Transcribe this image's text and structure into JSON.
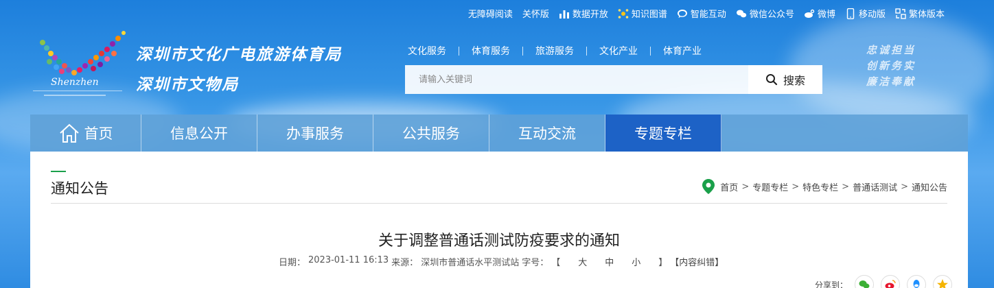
{
  "topbar": {
    "links": [
      {
        "label": "无障碍阅读",
        "icon": ""
      },
      {
        "label": "关怀版",
        "icon": ""
      },
      {
        "label": "数据开放",
        "icon": "bar-chart-icon"
      },
      {
        "label": "知识图谱",
        "icon": "knowledge-graph-icon"
      },
      {
        "label": "智能互动",
        "icon": "chat-bubble-icon"
      },
      {
        "label": "微信公众号",
        "icon": "wechat-icon"
      },
      {
        "label": "微博",
        "icon": "weibo-icon"
      },
      {
        "label": "移动版",
        "icon": "mobile-icon"
      },
      {
        "label": "繁体版本",
        "icon": "traditional-chinese-icon"
      }
    ]
  },
  "logo": {
    "text": "Shenzhen"
  },
  "site": {
    "name_line1": "深圳市文化广电旅游体育局",
    "name_line2": "深圳市文物局"
  },
  "subnav": [
    "文化服务",
    "体育服务",
    "旅游服务",
    "文化产业",
    "体育产业"
  ],
  "search": {
    "placeholder": "请输入关键词",
    "button_label": "搜索"
  },
  "slogan": [
    "忠诚担当",
    "创新务实",
    "廉洁奉献"
  ],
  "mainnav": {
    "items": [
      "首页",
      "信息公开",
      "办事服务",
      "公共服务",
      "互动交流",
      "专题专栏"
    ],
    "active_index": 5
  },
  "section": {
    "title": "通知公告"
  },
  "breadcrumb": [
    "首页",
    "专题专栏",
    "特色专栏",
    "普通话测试",
    "通知公告"
  ],
  "article": {
    "title": "关于调整普通话测试防疫要求的通知",
    "date_label": "日期：",
    "date": "2023-01-11 16:13",
    "source_label": "来源：",
    "source": "深圳市普通话水平测试站",
    "size_label": "字号：",
    "size_open": "【",
    "size_large": "大",
    "size_medium": "中",
    "size_small": "小",
    "size_close": "】",
    "correction": "【内容纠错】"
  },
  "share": {
    "label": "分享到：",
    "targets": [
      "wechat-share-icon",
      "weibo-share-icon",
      "qq-share-icon",
      "qzone-share-icon"
    ]
  },
  "colors": {
    "accent": "#1aa04a",
    "nav_active": "#1d62c6",
    "nav_bg": "#5fa0d7"
  }
}
